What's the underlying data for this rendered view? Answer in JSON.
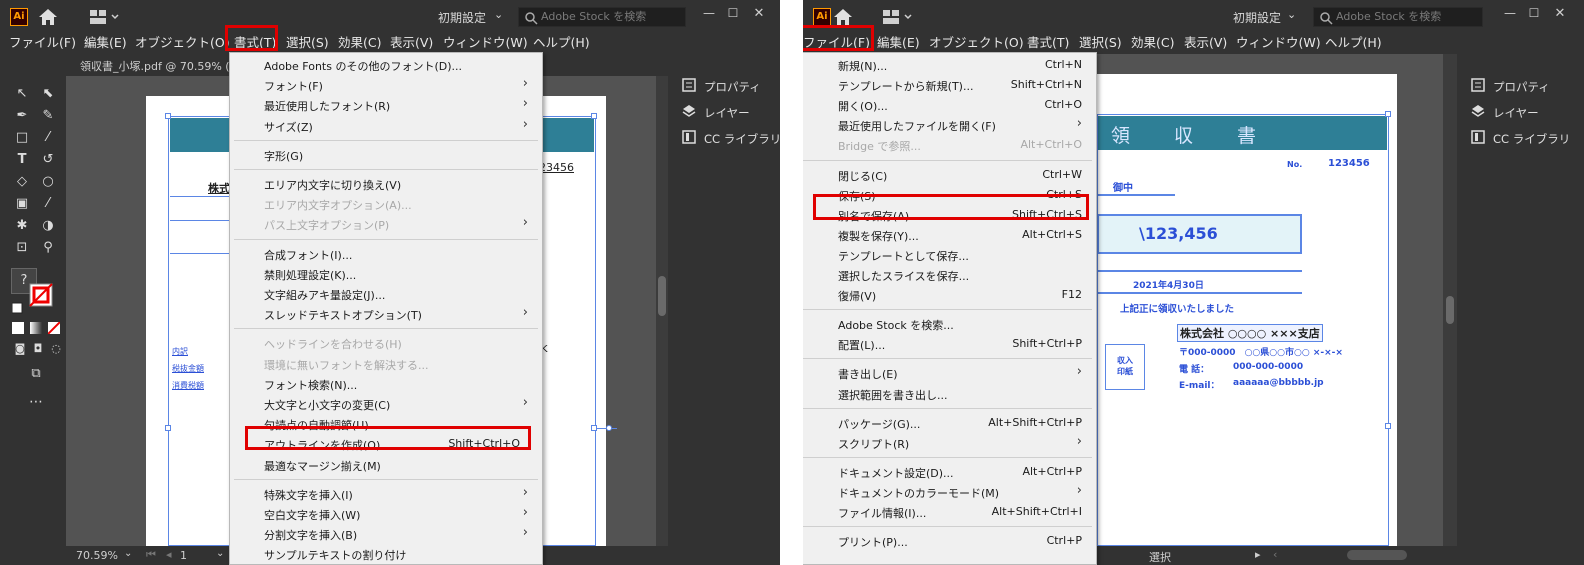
{
  "left": {
    "workspace": "初期設定",
    "stock_placeholder": "Adobe Stock を検索",
    "menubar": [
      "ファイル(F)",
      "編集(E)",
      "オブジェクト(O)",
      "書式(T)",
      "選択(S)",
      "効果(C)",
      "表示(V)",
      "ウィンドウ(W)",
      "ヘルプ(H)"
    ],
    "tab_title": "領収書_小塚.pdf @ 70.59% (RGB",
    "zoom": "70.59%",
    "page": "1",
    "menu": {
      "groups": [
        [
          {
            "label": "Adobe Fonts のその他のフォント(D)...",
            "shortcut": "",
            "submenu": false,
            "disabled": false
          },
          {
            "label": "フォント(F)",
            "shortcut": "",
            "submenu": true,
            "disabled": false
          },
          {
            "label": "最近使用したフォント(R)",
            "shortcut": "",
            "submenu": true,
            "disabled": false
          },
          {
            "label": "サイズ(Z)",
            "shortcut": "",
            "submenu": true,
            "disabled": false
          }
        ],
        [
          {
            "label": "字形(G)",
            "shortcut": "",
            "submenu": false,
            "disabled": false
          }
        ],
        [
          {
            "label": "エリア内文字に切り換え(V)",
            "shortcut": "",
            "submenu": false,
            "disabled": false
          },
          {
            "label": "エリア内文字オプション(A)...",
            "shortcut": "",
            "submenu": false,
            "disabled": true
          },
          {
            "label": "パス上文字オプション(P)",
            "shortcut": "",
            "submenu": true,
            "disabled": true
          }
        ],
        [
          {
            "label": "合成フォント(I)...",
            "shortcut": "",
            "submenu": false,
            "disabled": false
          },
          {
            "label": "禁則処理設定(K)...",
            "shortcut": "",
            "submenu": false,
            "disabled": false
          },
          {
            "label": "文字組みアキ量設定(J)...",
            "shortcut": "",
            "submenu": false,
            "disabled": false
          },
          {
            "label": "スレッドテキストオプション(T)",
            "shortcut": "",
            "submenu": true,
            "disabled": false
          }
        ],
        [
          {
            "label": "ヘッドラインを合わせる(H)",
            "shortcut": "",
            "submenu": false,
            "disabled": true
          },
          {
            "label": "環境に無いフォントを解決する...",
            "shortcut": "",
            "submenu": false,
            "disabled": true
          },
          {
            "label": "フォント検索(N)...",
            "shortcut": "",
            "submenu": false,
            "disabled": false
          },
          {
            "label": "大文字と小文字の変更(C)",
            "shortcut": "",
            "submenu": true,
            "disabled": false
          },
          {
            "label": "句読点の自動調節(U)...",
            "shortcut": "",
            "submenu": false,
            "disabled": false
          },
          {
            "label": "アウトラインを作成(O)",
            "shortcut": "Shift+Ctrl+O",
            "submenu": false,
            "disabled": false,
            "highlight": true
          },
          {
            "label": "最適なマージン揃え(M)",
            "shortcut": "",
            "submenu": false,
            "disabled": false
          }
        ],
        [
          {
            "label": "特殊文字を挿入(I)",
            "shortcut": "",
            "submenu": true,
            "disabled": false
          },
          {
            "label": "空白文字を挿入(W)",
            "shortcut": "",
            "submenu": true,
            "disabled": false
          },
          {
            "label": "分割文字を挿入(B)",
            "shortcut": "",
            "submenu": true,
            "disabled": false
          },
          {
            "label": "サンプルテキストの割り付け",
            "shortcut": "",
            "submenu": false,
            "disabled": false
          }
        ]
      ]
    },
    "doc_fragments": {
      "number_fragment": "23456",
      "company_fragment": "株式",
      "side_labels": [
        "内訳",
        "税抜金額",
        "消費税額"
      ],
      "trail_char": "K"
    },
    "dock": [
      "プロパティ",
      "レイヤー",
      "CC ライブラリ"
    ]
  },
  "right": {
    "workspace": "初期設定",
    "stock_placeholder": "Adobe Stock を検索",
    "menubar": [
      "ファイル(F)",
      "編集(E)",
      "オブジェクト(O)",
      "書式(T)",
      "選択(S)",
      "効果(C)",
      "表示(V)",
      "ウィンドウ(W)",
      "ヘルプ(H)"
    ],
    "status": "選択",
    "menu": {
      "groups": [
        [
          {
            "label": "新規(N)...",
            "shortcut": "Ctrl+N",
            "submenu": false,
            "disabled": false
          },
          {
            "label": "テンプレートから新規(T)...",
            "shortcut": "Shift+Ctrl+N",
            "submenu": false,
            "disabled": false
          },
          {
            "label": "開く(O)...",
            "shortcut": "Ctrl+O",
            "submenu": false,
            "disabled": false
          },
          {
            "label": "最近使用したファイルを開く(F)",
            "shortcut": "",
            "submenu": true,
            "disabled": false
          },
          {
            "label": "Bridge で参照...",
            "shortcut": "Alt+Ctrl+O",
            "submenu": false,
            "disabled": true
          }
        ],
        [
          {
            "label": "閉じる(C)",
            "shortcut": "Ctrl+W",
            "submenu": false,
            "disabled": false
          },
          {
            "label": "保存(S)",
            "shortcut": "Ctrl+S",
            "submenu": false,
            "disabled": false
          },
          {
            "label": "別名で保存(A)...",
            "shortcut": "Shift+Ctrl+S",
            "submenu": false,
            "disabled": false,
            "highlight": true
          },
          {
            "label": "複製を保存(Y)...",
            "shortcut": "Alt+Ctrl+S",
            "submenu": false,
            "disabled": false
          },
          {
            "label": "テンプレートとして保存...",
            "shortcut": "",
            "submenu": false,
            "disabled": false
          },
          {
            "label": "選択したスライスを保存...",
            "shortcut": "",
            "submenu": false,
            "disabled": false
          },
          {
            "label": "復帰(V)",
            "shortcut": "F12",
            "submenu": false,
            "disabled": false
          }
        ],
        [
          {
            "label": "Adobe Stock を検索...",
            "shortcut": "",
            "submenu": false,
            "disabled": false
          },
          {
            "label": "配置(L)...",
            "shortcut": "Shift+Ctrl+P",
            "submenu": false,
            "disabled": false
          }
        ],
        [
          {
            "label": "書き出し(E)",
            "shortcut": "",
            "submenu": true,
            "disabled": false
          },
          {
            "label": "選択範囲を書き出し...",
            "shortcut": "",
            "submenu": false,
            "disabled": false
          }
        ],
        [
          {
            "label": "パッケージ(G)...",
            "shortcut": "Alt+Shift+Ctrl+P",
            "submenu": false,
            "disabled": false
          },
          {
            "label": "スクリプト(R)",
            "shortcut": "",
            "submenu": true,
            "disabled": false
          }
        ],
        [
          {
            "label": "ドキュメント設定(D)...",
            "shortcut": "Alt+Ctrl+P",
            "submenu": false,
            "disabled": false
          },
          {
            "label": "ドキュメントのカラーモード(M)",
            "shortcut": "",
            "submenu": true,
            "disabled": false
          },
          {
            "label": "ファイル情報(I)...",
            "shortcut": "Alt+Shift+Ctrl+I",
            "submenu": false,
            "disabled": false
          }
        ],
        [
          {
            "label": "プリント(P)...",
            "shortcut": "Ctrl+P",
            "submenu": false,
            "disabled": false
          }
        ]
      ]
    },
    "document": {
      "title": "領　　収　　書",
      "no_label": "No.",
      "no_value": "123456",
      "addressee": "御中",
      "amount": "\\123,456",
      "date": "2021年4月30日",
      "received_text": "上記正に領収いたしました",
      "company": "株式会社 ○○○○ ×××支店",
      "address": "〒000-0000　○○県○○市○○ ×-×-×",
      "phone_label": "電 話：",
      "phone": "000-000-0000",
      "email_label": "E-mail：",
      "email": "aaaaaa@bbbbb.jp",
      "stamp": "収入\n印紙"
    },
    "dock": [
      "プロパティ",
      "レイヤー",
      "CC ライブラリ"
    ]
  },
  "colors": {
    "ui_dark": "#323232",
    "canvas": "#535353",
    "highlight_red": "#e00000",
    "doc_blue": "#2b4fd6",
    "header_teal": "#2e7f96"
  }
}
